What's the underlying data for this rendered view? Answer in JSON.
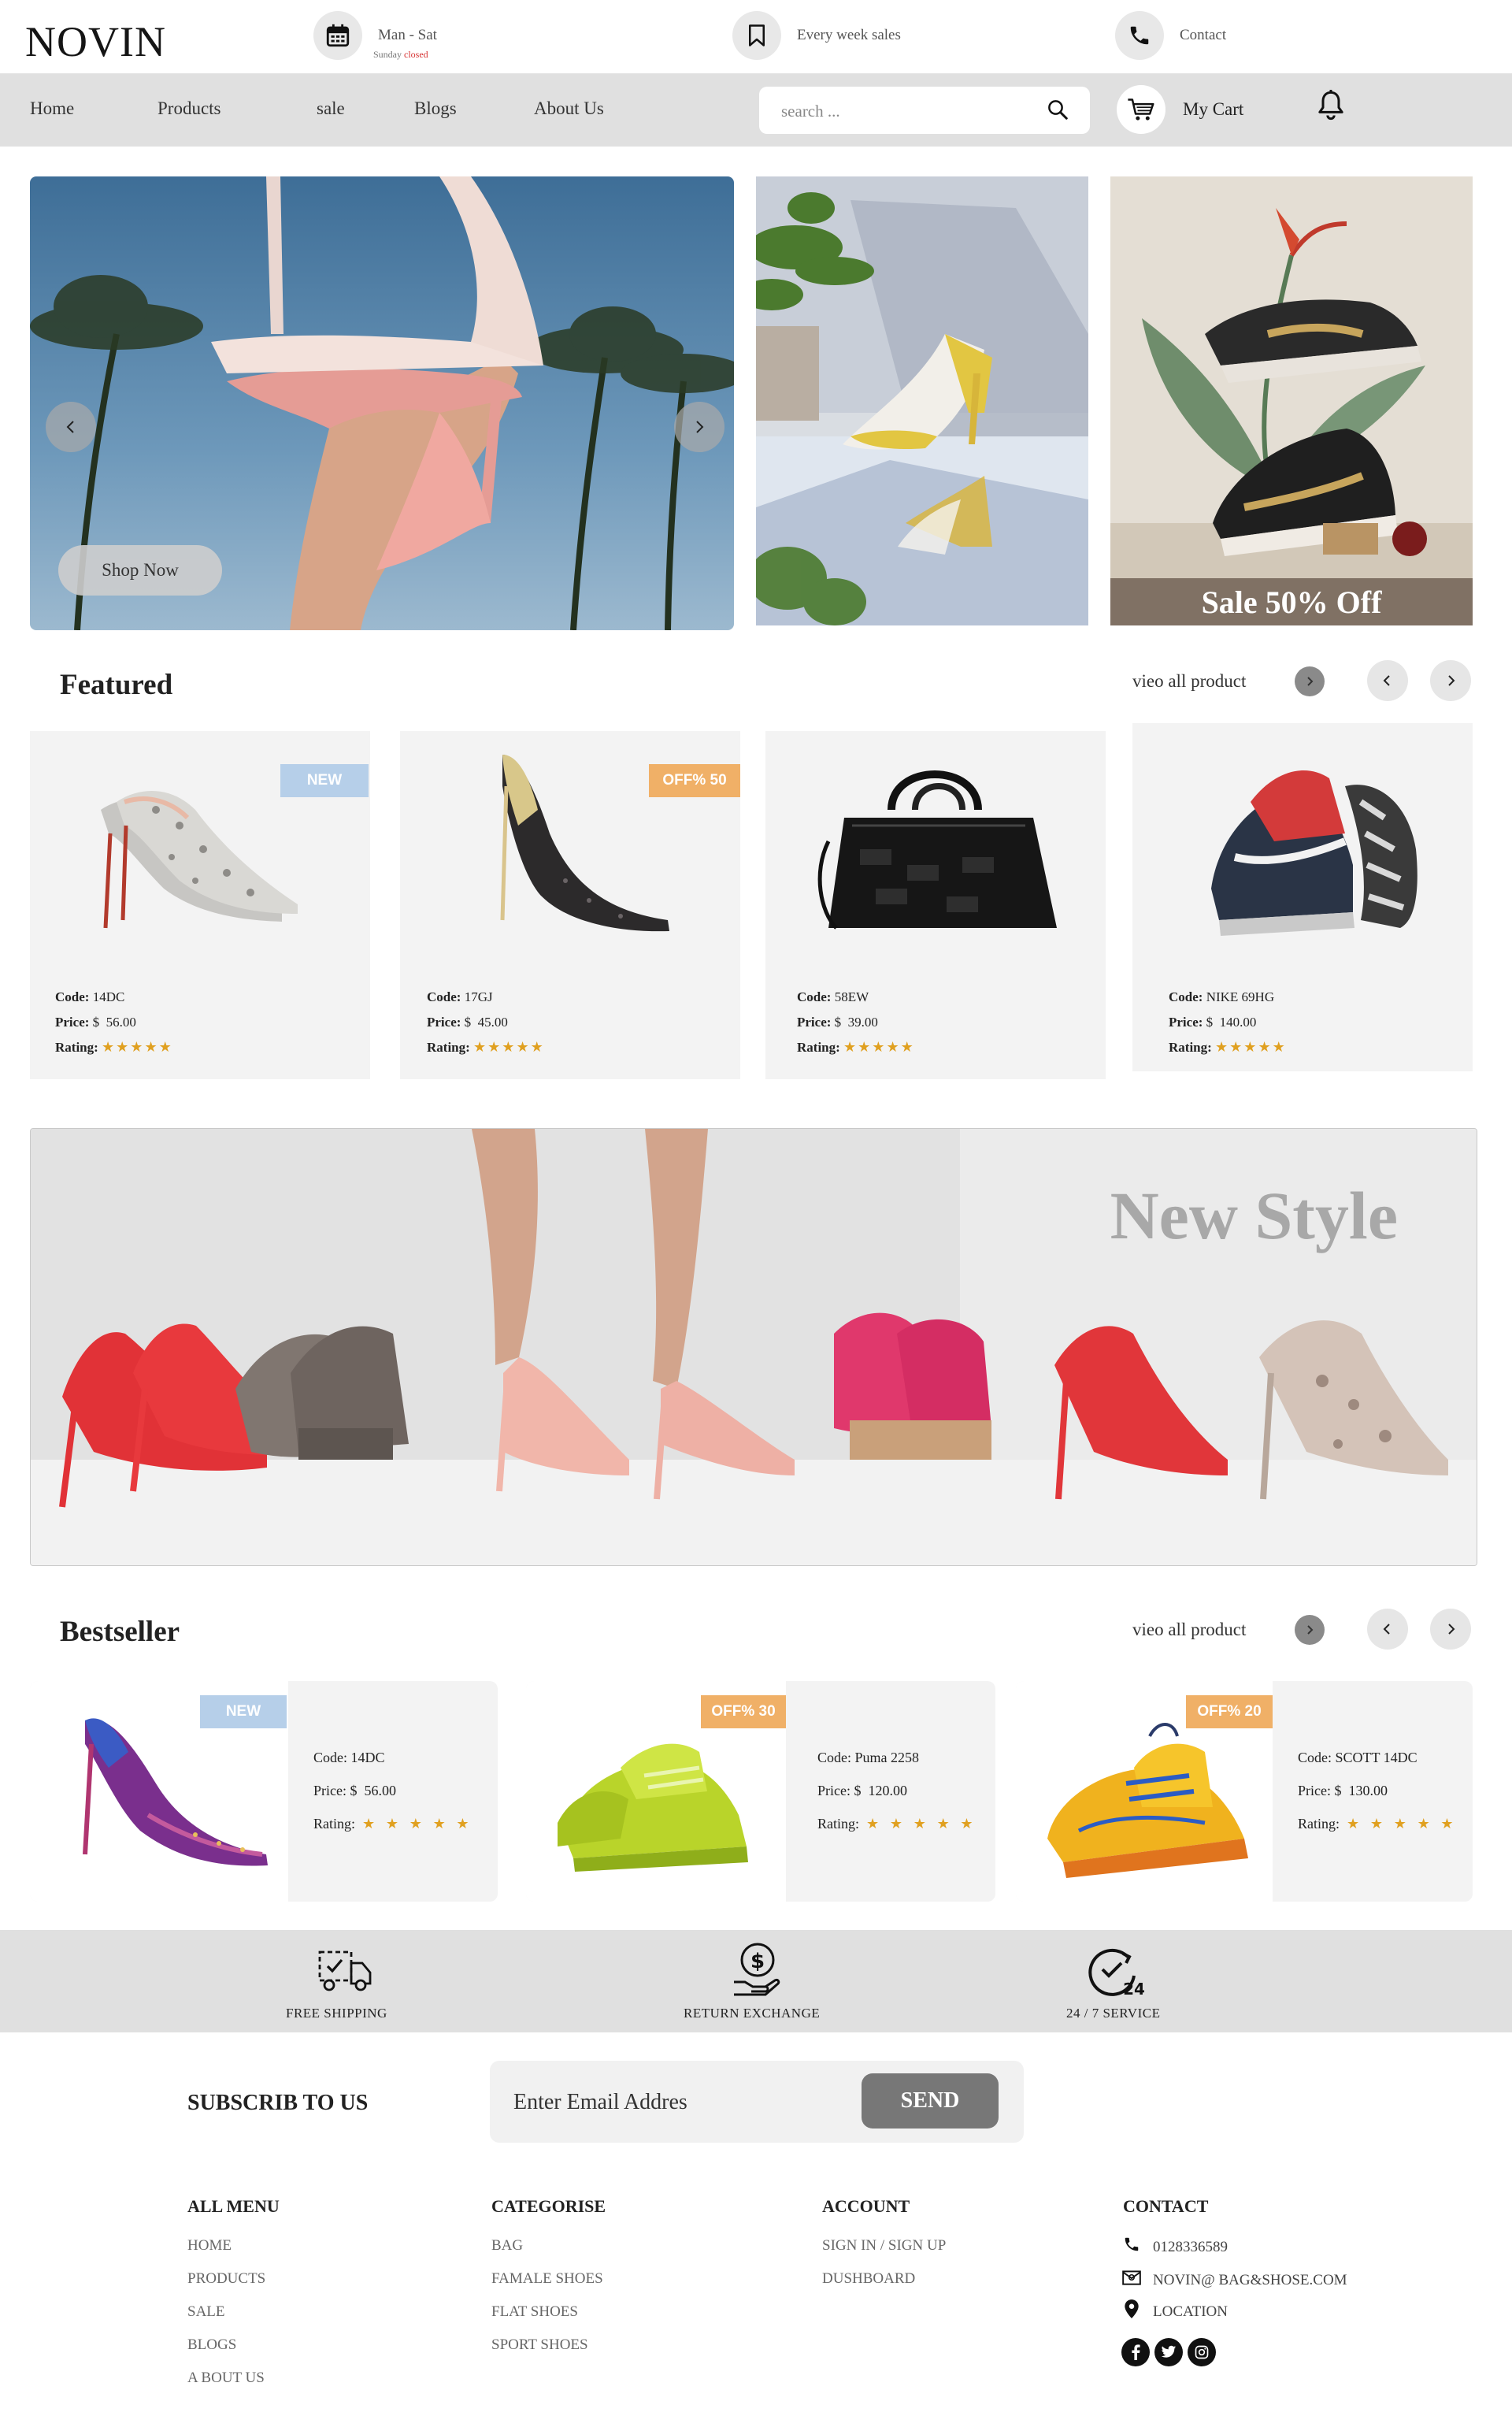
{
  "brand": {
    "logo": "NOVIN"
  },
  "topbar": {
    "hours": "Man - Sat",
    "sunday_prefix": "Sunday",
    "sunday_status": "closed",
    "sales": "Every week sales",
    "contact": "Contact",
    "icons": [
      "calendar-icon",
      "bookmark-icon",
      "phone-icon"
    ]
  },
  "nav": {
    "items": [
      "Home",
      "Products",
      "sale",
      "Blogs",
      "About Us"
    ],
    "search_placeholder": "search ...",
    "cart_label": "My Cart"
  },
  "hero": {
    "shop_now": "Shop Now",
    "sale_label": "Sale 50% Off"
  },
  "featured": {
    "title": "Featured",
    "view_all": "vieo all product",
    "code_label": "Code:",
    "price_label": "Price:",
    "rating_label": "Rating:",
    "currency": "$",
    "items": [
      {
        "code": "14DC",
        "price": "56.00",
        "rating": 5,
        "badge": "NEW"
      },
      {
        "code": "17GJ",
        "price": "45.00",
        "rating": 5,
        "badge": "OFF% 50"
      },
      {
        "code": "58EW",
        "price": "39.00",
        "rating": 5,
        "badge": ""
      },
      {
        "code": "NIKE 69HG",
        "price": "140.00",
        "rating": 5,
        "badge": ""
      }
    ]
  },
  "banner": {
    "title": "New Style"
  },
  "bestseller": {
    "title": "Bestseller",
    "view_all": "vieo all product",
    "items": [
      {
        "code": "14DC",
        "price": "56.00",
        "rating": 5,
        "badge": "NEW"
      },
      {
        "code": "Puma 2258",
        "price": "120.00",
        "rating": 5,
        "badge": "OFF% 30"
      },
      {
        "code": "SCOTT 14DC",
        "price": "130.00",
        "rating": 5,
        "badge": "OFF% 20"
      }
    ]
  },
  "services": [
    {
      "label": "FREE SHIPPING",
      "icon": "delivery-truck-icon"
    },
    {
      "label": "RETURN EXCHANGE",
      "icon": "money-hand-icon"
    },
    {
      "label": "24 / 7 SERVICE",
      "icon": "clock-24-icon"
    }
  ],
  "subscribe": {
    "title": "SUBSCRIB TO US",
    "placeholder": "Enter Email Addres",
    "button": "SEND"
  },
  "footer": {
    "menu": {
      "title": "ALL MENU",
      "links": [
        "HOME",
        "PRODUCTS",
        "SALE",
        "BLOGS",
        "A BOUT US"
      ]
    },
    "categories": {
      "title": "CATEGORISE",
      "links": [
        "BAG",
        "FAMALE SHOES",
        "FLAT SHOES",
        "SPORT SHOES"
      ]
    },
    "account": {
      "title": "ACCOUNT",
      "links": [
        "SIGN IN / SIGN UP",
        "DUSHBOARD"
      ]
    },
    "contact": {
      "title": "CONTACT",
      "phone": "0128336589",
      "email": "NOVIN@ BAG&SHOSE.COM",
      "location": "LOCATION"
    }
  },
  "colors": {
    "accent_star": "#e0a020",
    "badge_new": "#b6cfe9",
    "badge_off": "#f0b067",
    "nav_bg": "#e0e0e0",
    "closed_red": "#d63232"
  }
}
